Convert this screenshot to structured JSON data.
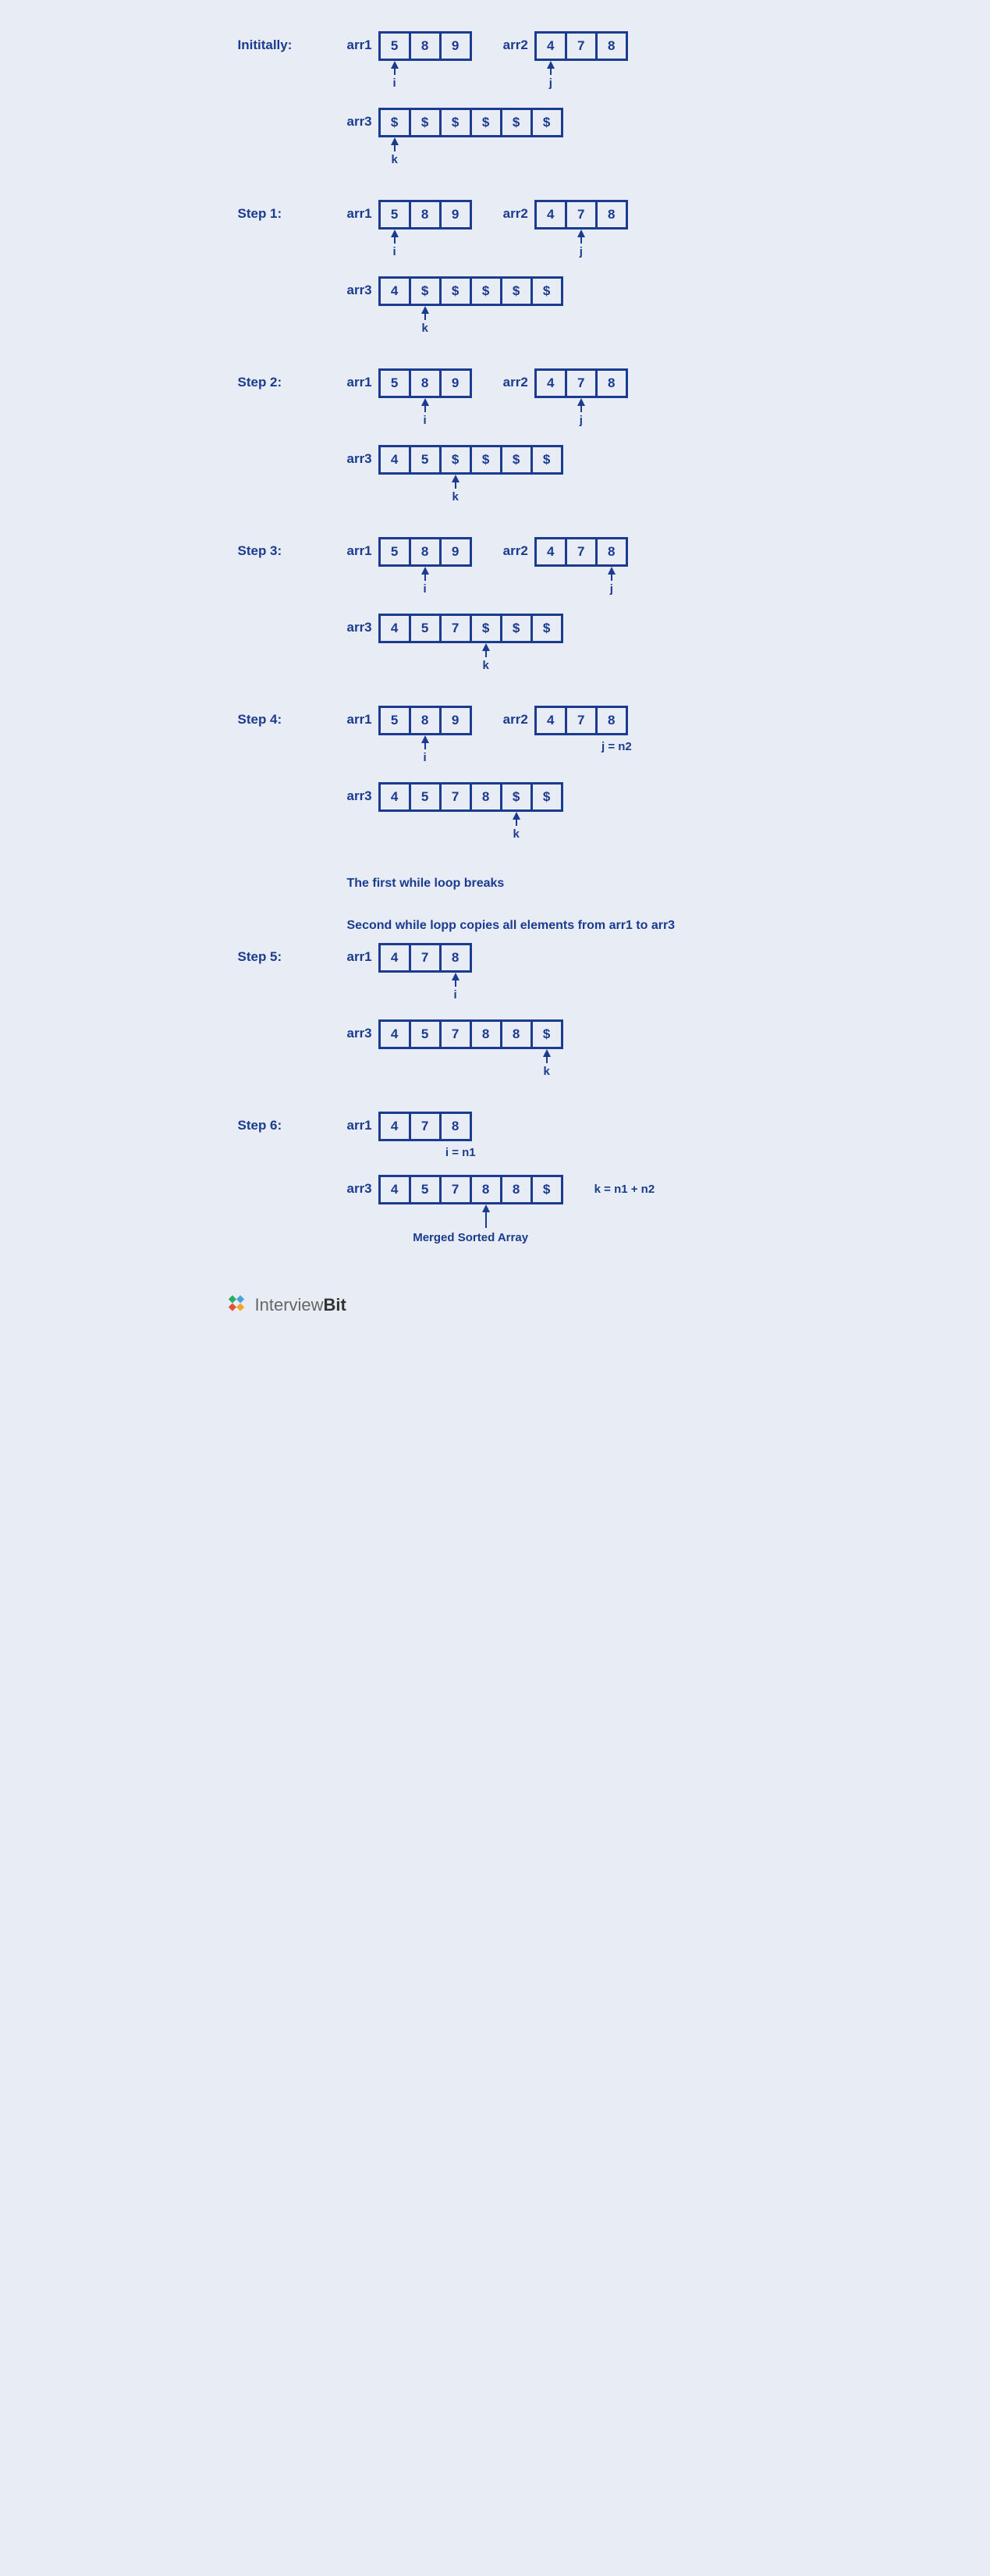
{
  "steps": [
    {
      "title": "Inititally:",
      "arr1": {
        "v": [
          "5",
          "8",
          "9"
        ],
        "p": 0,
        "pl": "i"
      },
      "arr2": {
        "v": [
          "4",
          "7",
          "8"
        ],
        "p": 0,
        "pl": "j"
      },
      "arr3": {
        "v": [
          "$",
          "$",
          "$",
          "$",
          "$",
          "$"
        ],
        "p": 0,
        "pl": "k"
      }
    },
    {
      "title": "Step 1:",
      "arr1": {
        "v": [
          "5",
          "8",
          "9"
        ],
        "p": 0,
        "pl": "i"
      },
      "arr2": {
        "v": [
          "4",
          "7",
          "8"
        ],
        "p": 1,
        "pl": "j"
      },
      "arr3": {
        "v": [
          "4",
          "$",
          "$",
          "$",
          "$",
          "$"
        ],
        "p": 1,
        "pl": "k"
      }
    },
    {
      "title": "Step 2:",
      "arr1": {
        "v": [
          "5",
          "8",
          "9"
        ],
        "p": 1,
        "pl": "i"
      },
      "arr2": {
        "v": [
          "4",
          "7",
          "8"
        ],
        "p": 1,
        "pl": "j"
      },
      "arr3": {
        "v": [
          "4",
          "5",
          "$",
          "$",
          "$",
          "$"
        ],
        "p": 2,
        "pl": "k"
      }
    },
    {
      "title": "Step 3:",
      "arr1": {
        "v": [
          "5",
          "8",
          "9"
        ],
        "p": 1,
        "pl": "i"
      },
      "arr2": {
        "v": [
          "4",
          "7",
          "8"
        ],
        "p": 2,
        "pl": "j"
      },
      "arr3": {
        "v": [
          "4",
          "5",
          "7",
          "$",
          "$",
          "$"
        ],
        "p": 3,
        "pl": "k"
      }
    },
    {
      "title": "Step 4:",
      "arr1": {
        "v": [
          "5",
          "8",
          "9"
        ],
        "p": 1,
        "pl": "i"
      },
      "arr2": {
        "v": [
          "4",
          "7",
          "8"
        ],
        "note": "j = n2"
      },
      "arr3": {
        "v": [
          "4",
          "5",
          "7",
          "8",
          "$",
          "$"
        ],
        "p": 4,
        "pl": "k"
      }
    }
  ],
  "msg1": "The first while loop breaks",
  "msg2": "Second while lopp copies all elements from arr1 to arr3",
  "step5": {
    "title": "Step 5:",
    "arr1": {
      "v": [
        "4",
        "7",
        "8"
      ],
      "p": 2,
      "pl": "i"
    },
    "arr3": {
      "v": [
        "4",
        "5",
        "7",
        "8",
        "8",
        "$"
      ],
      "p": 5,
      "pl": "k"
    }
  },
  "step6": {
    "title": "Step 6:",
    "arr1": {
      "v": [
        "4",
        "7",
        "8"
      ],
      "note": "i = n1"
    },
    "arr3": {
      "v": [
        "4",
        "5",
        "7",
        "8",
        "8",
        "$"
      ],
      "finalLabel": "Merged Sorted Array",
      "sideNote": "k = n1 + n2",
      "arrowAt": 3
    }
  },
  "labels": {
    "arr1": "arr1",
    "arr2": "arr2",
    "arr3": "arr3"
  },
  "logo": {
    "a": "Interview",
    "b": "Bit"
  }
}
